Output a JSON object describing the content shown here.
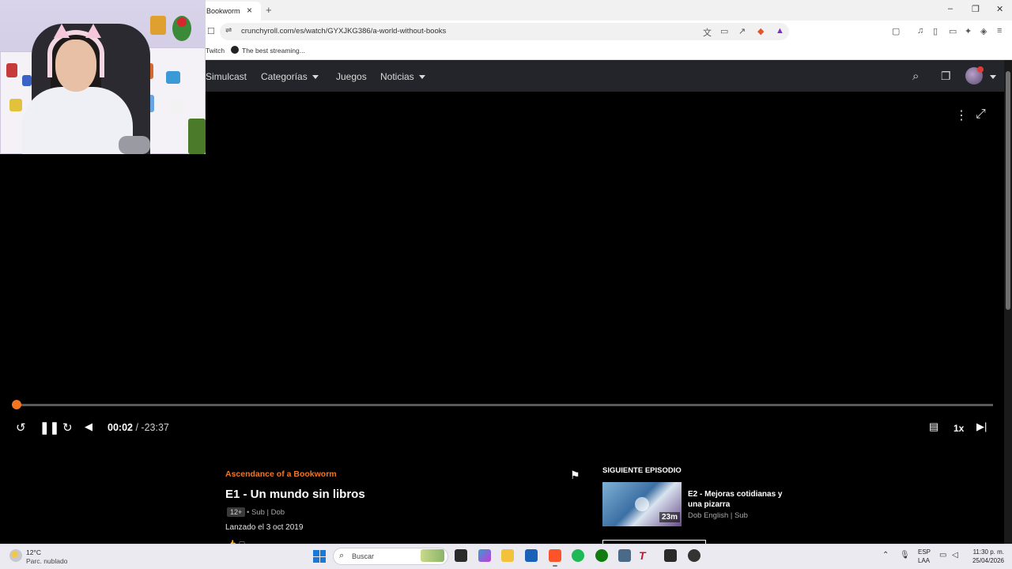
{
  "browser": {
    "tab_title": "Bookworm",
    "tab_close": "×",
    "new_tab": "+",
    "url": "crunchyroll.com/es/watch/GYXJKG386/a-world-without-books",
    "window_controls": [
      "–",
      "❐",
      "✕"
    ],
    "bookmarks": [
      "Twitch",
      "The best streaming..."
    ]
  },
  "site_nav": {
    "items": [
      "Simulcast",
      "Categorías",
      "Juegos",
      "Noticias"
    ]
  },
  "player": {
    "current_time": "00:02",
    "separator": " / ",
    "remaining_time": "-23:37",
    "speed": "1x",
    "progress_fraction": 0.001
  },
  "episode": {
    "series": "Ascendance of a Bookworm",
    "title": "E1 - Un mundo sin libros",
    "rating": "12+",
    "audio": "• Sub | Dob",
    "release": "Lanzado el 3 oct 2019"
  },
  "next_episode": {
    "heading": "SIGUIENTE EPISODIO",
    "title": "E2 - Mejoras cotidianas y una pizarra",
    "duration": "23m",
    "audio": "Dob English | Sub"
  },
  "taskbar": {
    "temperature": "12°C",
    "weather": "Parc. nublado",
    "search_placeholder": "Buscar",
    "lang_line1": "ESP",
    "lang_line2": "LAA",
    "time": "11:30 p. m.",
    "date": "25/04/2026"
  },
  "colors": {
    "accent": "#f47521",
    "nav_bg": "#23252b",
    "page_bg": "#000000"
  }
}
